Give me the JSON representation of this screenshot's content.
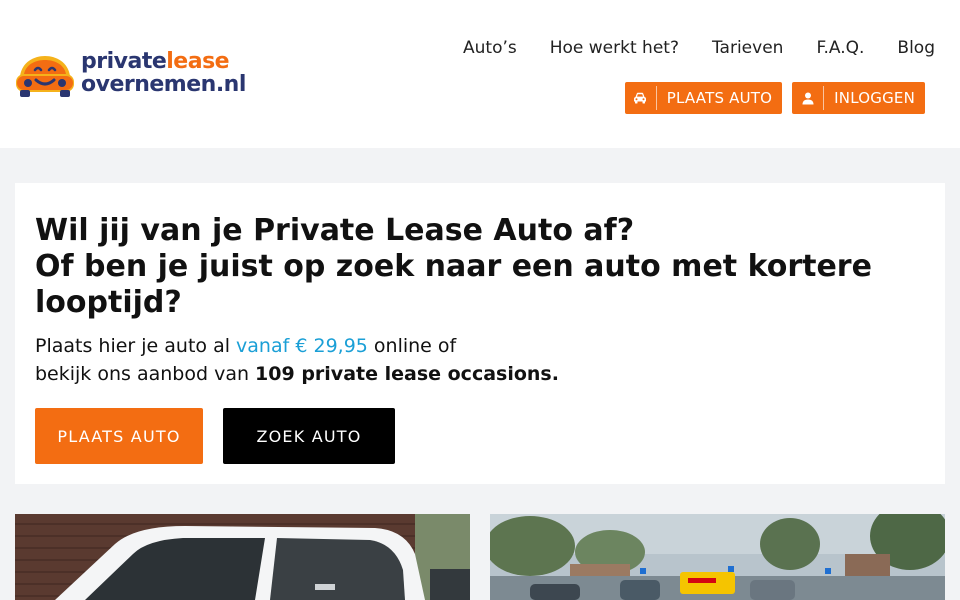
{
  "logo": {
    "word_private": "private",
    "word_lease": "lease",
    "line2": "overnemen.nl"
  },
  "nav": {
    "items": [
      "Auto’s",
      "Hoe werkt het?",
      "Tarieven",
      "F.A.Q.",
      "Blog"
    ]
  },
  "header_actions": {
    "place_car": "PLAATS AUTO",
    "login": "INLOGGEN"
  },
  "hero": {
    "title_line1": "Wil jij van je Private Lease Auto af?",
    "title_line2": "Of ben je juist op zoek naar een auto met kortere looptijd?",
    "lead_1": "Plaats hier je auto al ",
    "lead_price": "vanaf € 29,95",
    "lead_2": " online of",
    "lead_3": "bekijk ons aanbod van ",
    "lead_bold": "109 private lease occasions.",
    "cta_place": "PLAATS AUTO",
    "cta_search": "ZOEK AUTO"
  },
  "colors": {
    "brand_orange": "#f36d12",
    "brand_navy": "#2a3670",
    "price_blue": "#1a9fd6"
  },
  "icons": {
    "place_car": "car-icon",
    "login": "user-icon"
  }
}
